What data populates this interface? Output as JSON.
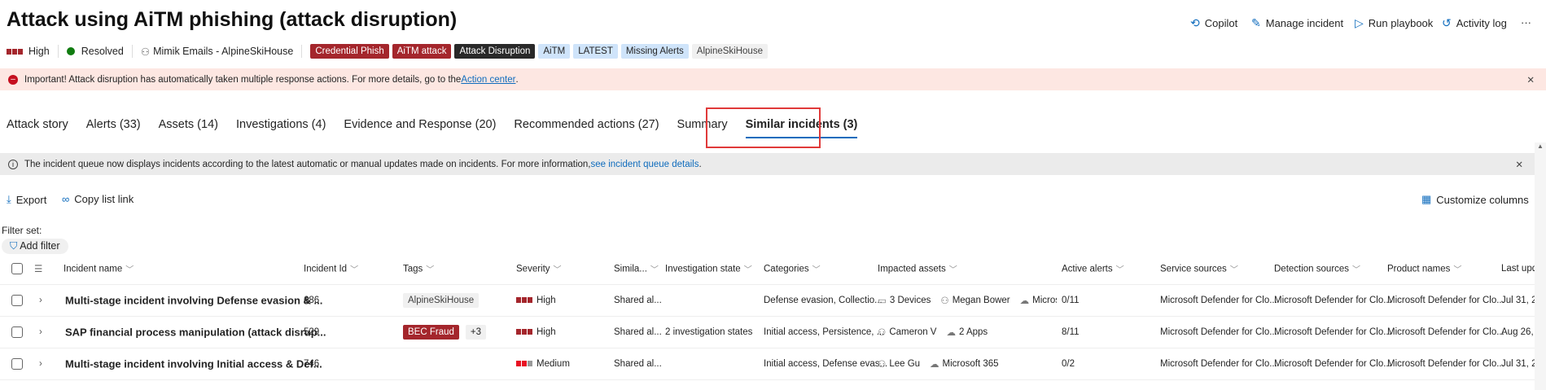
{
  "title": "Attack using AiTM phishing (attack disruption)",
  "actions": [
    {
      "label": "Copilot",
      "icon": "copilot-icon"
    },
    {
      "label": "Manage incident",
      "icon": "pencil-icon"
    },
    {
      "label": "Run playbook",
      "icon": "play-icon"
    },
    {
      "label": "Activity log",
      "icon": "history-icon"
    }
  ],
  "more": "···",
  "meta": {
    "severity": "High",
    "status": "Resolved",
    "owner": "Mimik Emails - AlpineSkiHouse"
  },
  "tags": [
    {
      "label": "Credential Phish",
      "bg": "#a4262c",
      "fg": "#fff"
    },
    {
      "label": "AiTM attack",
      "bg": "#a4262c",
      "fg": "#fff"
    },
    {
      "label": "Attack Disruption",
      "bg": "#292929",
      "fg": "#fff"
    },
    {
      "label": "AiTM",
      "bg": "#cfe4fa",
      "fg": "#242424"
    },
    {
      "label": "LATEST",
      "bg": "#cfe4fa",
      "fg": "#242424"
    },
    {
      "label": "Missing Alerts",
      "bg": "#cfe4fa",
      "fg": "#242424"
    },
    {
      "label": "AlpineSkiHouse",
      "bg": "#f0f0f0",
      "fg": "#424242"
    }
  ],
  "banner": {
    "text": "Important! Attack disruption has automatically taken multiple response actions. For more details, go to the ",
    "link": "Action center",
    "end": "."
  },
  "tabs": [
    "Attack story",
    "Alerts (33)",
    "Assets (14)",
    "Investigations (4)",
    "Evidence and Response (20)",
    "Recommended actions (27)",
    "Summary",
    "Similar incidents (3)"
  ],
  "info": {
    "text": "The incident queue now displays incidents according to the latest automatic or manual updates made on incidents. For more information, ",
    "link": "see incident queue details",
    "end": "."
  },
  "toolbar": {
    "export": "Export",
    "copy": "Copy list link",
    "customize": "Customize columns"
  },
  "filter": {
    "label": "Filter set:",
    "add": "Add filter"
  },
  "columns": [
    "Incident name",
    "Incident Id",
    "Tags",
    "Severity",
    "Simila...",
    "Investigation state",
    "Categories",
    "Impacted assets",
    "Active alerts",
    "Service sources",
    "Detection sources",
    "Product names",
    "Last upd"
  ],
  "rows": [
    {
      "name": "Multi-stage incident involving Defense evasion & ...",
      "id": "686",
      "tag": "AlpineSkiHouse",
      "tagExtra": "",
      "severity": "High",
      "similar": "Shared al...",
      "inv": "",
      "cat": "Defense evasion, Collectio...",
      "assets": [
        {
          "icon": "laptop-icon",
          "label": "3 Devices"
        },
        {
          "icon": "user-icon",
          "label": "Megan Bower"
        },
        {
          "icon": "cloud-icon",
          "label": "Microso"
        }
      ],
      "active": "0/11",
      "service": "Microsoft Defender for Clo...",
      "detection": "Microsoft Defender for Clo...",
      "product": "Microsoft Defender for Clo...",
      "last": "Jul 31, 2"
    },
    {
      "name": "SAP financial process manipulation (attack disrup...",
      "id": "529",
      "tag": "BEC Fraud",
      "tagExtra": "+3",
      "severity": "High",
      "similar": "Shared al...",
      "inv": "2 investigation states",
      "cat": "Initial access, Persistence, ...",
      "assets": [
        {
          "icon": "user-icon",
          "label": "Cameron V"
        },
        {
          "icon": "cloud-icon",
          "label": "2 Apps"
        }
      ],
      "active": "8/11",
      "service": "Microsoft Defender for Clo...",
      "detection": "Microsoft Defender for Clo...",
      "product": "Microsoft Defender for Clo...",
      "last": "Aug 26,"
    },
    {
      "name": "Multi-stage incident involving Initial access & Def...",
      "id": "746",
      "tag": "",
      "tagExtra": "",
      "severity": "Medium",
      "similar": "Shared al...",
      "inv": "",
      "cat": "Initial access, Defense evas...",
      "assets": [
        {
          "icon": "user-icon",
          "label": "Lee Gu"
        },
        {
          "icon": "cloud-icon",
          "label": "Microsoft 365"
        }
      ],
      "active": "0/2",
      "service": "Microsoft Defender for Clo...",
      "detection": "Microsoft Defender for Clo...",
      "product": "Microsoft Defender for Clo...",
      "last": "Jul 31, 2"
    }
  ],
  "colors": {
    "high": "#a4262c",
    "medium": "#e81123",
    "accent": "#0f6cbd",
    "resolved": "#107c10"
  }
}
